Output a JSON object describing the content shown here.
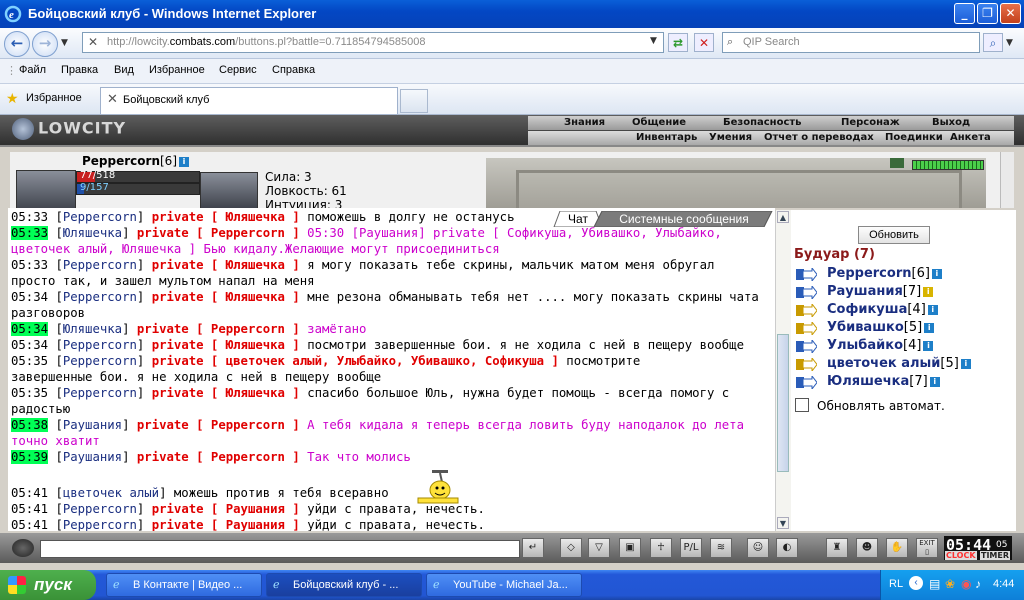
{
  "window": {
    "title": "Бойцовский клуб - Windows Internet Explorer"
  },
  "browser": {
    "url_prefix": "http://lowcity.",
    "url_host": "combats.com",
    "url_suffix": "/buttons.pl?battle=0.711854794585008",
    "search_placeholder": "QIP Search",
    "menu": [
      "Файл",
      "Правка",
      "Вид",
      "Избранное",
      "Сервис",
      "Справка"
    ],
    "favorites_label": "Избранное",
    "tab_title": "Бойцовский клуб"
  },
  "game": {
    "logo": "LOWCITY",
    "nav_top": [
      "Знания",
      "Общение",
      "Безопасность",
      "Персонаж",
      "Выход"
    ],
    "nav_bottom": [
      "Инвентарь",
      "Умения",
      "Отчет о переводах",
      "Поединки",
      "Анкета"
    ],
    "character": {
      "name": "Peppercorn",
      "level": "[6]",
      "hp_text": "77/518",
      "hp_fraction": 0.149,
      "mp_text": "9/157",
      "mp_fraction": 0.057,
      "stats": [
        "Сила: 3",
        "Ловкость: 61",
        "Интуиция: 3"
      ]
    },
    "chat_tabs": {
      "chat": "Чат",
      "system": "Системные сообщения"
    },
    "chat": [
      {
        "ts": "05:33",
        "hl": false,
        "nick": "Peppercorn",
        "priv": "private [ Юляшечка ]",
        "msg": "поможешь в долгу не останусь",
        "pink": false
      },
      {
        "ts": "05:33",
        "hl": true,
        "nick": "Юляшечка",
        "priv": "private [ Peppercorn ]",
        "msg": "05:30 [Раушания] private [ Софикуша, Убивашко, Улыбайко,",
        "pink": true
      },
      {
        "ts": "",
        "hl": false,
        "nick": "",
        "priv": "",
        "msg": "цветочек алый, Юляшечка ] Бью кидалу.Желающие могут присоединиться",
        "pink": true
      },
      {
        "ts": "05:33",
        "hl": false,
        "nick": "Peppercorn",
        "priv": "private [ Юляшечка ]",
        "msg": "я могу показать тебе скрины, мальчик матом меня обругал",
        "pink": false
      },
      {
        "ts": "",
        "hl": false,
        "nick": "",
        "priv": "",
        "msg": "просто так, и зашел мультом напал на меня",
        "pink": false
      },
      {
        "ts": "05:34",
        "hl": false,
        "nick": "Peppercorn",
        "priv": "private [ Юляшечка ]",
        "msg": "мне резона обманывать тебя нет .... могу показать скрины чата",
        "pink": false
      },
      {
        "ts": "",
        "hl": false,
        "nick": "",
        "priv": "",
        "msg": "разговоров",
        "pink": false
      },
      {
        "ts": "05:34",
        "hl": true,
        "nick": "Юляшечка",
        "priv": "private [ Peppercorn ]",
        "msg": "замётано",
        "pink": true
      },
      {
        "ts": "05:34",
        "hl": false,
        "nick": "Peppercorn",
        "priv": "private [ Юляшечка ]",
        "msg": "посмотри завершенные бои. я не ходила с ней в пещеру вообще",
        "pink": false
      },
      {
        "ts": "05:35",
        "hl": false,
        "nick": "Peppercorn",
        "priv": "private [ цветочек алый, Улыбайко, Убивашко, Софикуша ]",
        "msg": "посмотрите",
        "pink": false
      },
      {
        "ts": "",
        "hl": false,
        "nick": "",
        "priv": "",
        "msg": "завершенные бои. я не ходила с ней в пещеру вообще",
        "pink": false
      },
      {
        "ts": "05:35",
        "hl": false,
        "nick": "Peppercorn",
        "priv": "private [ Юляшечка ]",
        "msg": "спасибо большое Юль, нужна будет помощь - всегда помогу с",
        "pink": false
      },
      {
        "ts": "",
        "hl": false,
        "nick": "",
        "priv": "",
        "msg": "радостью",
        "pink": false
      },
      {
        "ts": "05:38",
        "hl": true,
        "nick": "Раушания",
        "priv": "private [ Peppercorn ]",
        "msg": "А тебя кидала я теперь всегда ловить буду наподалок до лета",
        "pink": true
      },
      {
        "ts": "",
        "hl": false,
        "nick": "",
        "priv": "",
        "msg": "точно хватит",
        "pink": true
      },
      {
        "ts": "05:39",
        "hl": true,
        "nick": "Раушания",
        "priv": "private [ Peppercorn ]",
        "msg": "Так что молись",
        "pink": true
      },
      {
        "ts": "",
        "hl": false,
        "nick": "",
        "priv": "",
        "msg": "",
        "pink": false
      },
      {
        "ts": "05:41",
        "hl": false,
        "nick": "цветочек алый",
        "priv": "",
        "msg": "можешь против я тебя всеравно",
        "pink": false
      },
      {
        "ts": "05:41",
        "hl": false,
        "nick": "Peppercorn",
        "priv": "private [ Раушания ]",
        "msg": "уйди с правата, нечесть.",
        "pink": false
      },
      {
        "ts": "05:41",
        "hl": false,
        "nick": "Peppercorn",
        "priv": "private [ Раушания ]",
        "msg": "уйди с правата, нечесть.",
        "pink": false
      }
    ],
    "right_panel": {
      "refresh_label": "Обновить",
      "room_title": "Будуар (7)",
      "users": [
        {
          "name": "Peppercorn",
          "level": "[6]",
          "badge": "i",
          "icon_color": "#2a5cb8"
        },
        {
          "name": "Раушания",
          "level": "[7]",
          "badge": "i",
          "icon_color": "#2a5cb8"
        },
        {
          "name": "Софикуша",
          "level": "[4]",
          "badge": "i",
          "icon_color": "#c89a00"
        },
        {
          "name": "Убивашко",
          "level": "[5]",
          "badge": "i",
          "icon_color": "#c89a00"
        },
        {
          "name": "Улыбайко",
          "level": "[4]",
          "badge": "i",
          "icon_color": "#2a5cb8"
        },
        {
          "name": "цветочек алый",
          "level": "[5]",
          "badge": "i",
          "icon_color": "#c89a00"
        },
        {
          "name": "Юляшечка",
          "level": "[7]",
          "badge": "i",
          "icon_color": "#2a5cb8"
        }
      ],
      "auto_refresh_label": "Обновлять автомат."
    },
    "clock": {
      "time": "05:44",
      "seconds": "05",
      "clock_label": "CLOCK",
      "timer_label": "TIMER",
      "exit_label": "EXIT"
    }
  },
  "taskbar": {
    "start_label": "пуск",
    "tasks": [
      "В Контакте | Видео ...",
      "Бойцовский клуб - ...",
      "YouTube - Michael Ja..."
    ],
    "lang": "RL",
    "time": "4:44"
  }
}
